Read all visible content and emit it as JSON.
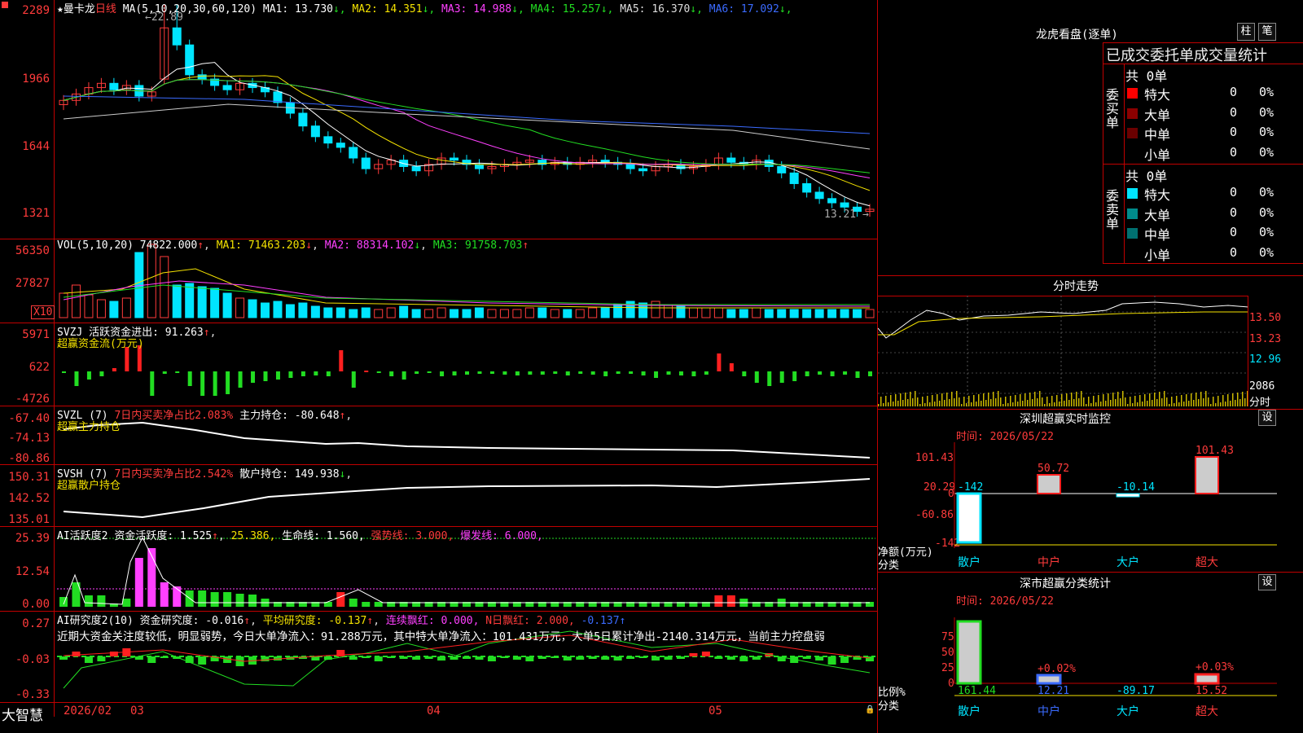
{
  "stock": {
    "star": "★",
    "name": "曼卡龙",
    "period": "日线"
  },
  "main": {
    "ma_title": "MA(5,10,20,30,60,120)",
    "ma": [
      {
        "label": "MA1: 13.730",
        "arrow": "↓",
        "color": "#ffffff"
      },
      {
        "label": "MA2: 14.351",
        "arrow": "↓",
        "color": "#f4e200"
      },
      {
        "label": "MA3: 14.988",
        "arrow": "↓",
        "color": "#ff40ff"
      },
      {
        "label": "MA4: 15.257",
        "arrow": "↓",
        "color": "#22dd22"
      },
      {
        "label": "MA5: 16.370",
        "arrow": "↓",
        "color": "#dddddd"
      },
      {
        "label": "MA6: 17.092",
        "arrow": "↓",
        "color": "#3b6bff"
      }
    ],
    "y_ticks": [
      "2289",
      "1966",
      "1644",
      "1321"
    ],
    "high_mark": "22.89",
    "low_mark": "13.21"
  },
  "vol": {
    "title": "VOL(5,10,20)",
    "v": "74822.000",
    "ma1": "MA1: 71463.203",
    "ma2": "MA2: 88314.102",
    "ma3": "MA3: 91758.703",
    "y_ticks": [
      "56350",
      "27827"
    ],
    "unit": "X10"
  },
  "svzj": {
    "title": "SVZJ",
    "t1": "活跃资金进出: 91.263",
    "t2": "超赢资金流(万元)",
    "y_ticks": [
      "5971",
      "622",
      "-4726"
    ]
  },
  "svzl": {
    "title": "SVZL (7)",
    "t1": "7日内买卖净占比2.083%",
    "t2": "主力持仓: -80.648",
    "t3": "超赢主力持仓",
    "y_ticks": [
      "-67.40",
      "-74.13",
      "-80.86"
    ]
  },
  "svsh": {
    "title": "SVSH (7)",
    "t1": "7日内买卖净占比2.542%",
    "t2": "散户持仓: 149.938",
    "t3": "超赢散户持仓",
    "y_ticks": [
      "150.31",
      "142.52",
      "135.01"
    ]
  },
  "ai1": {
    "title": "AI活跃度2",
    "t1": "资金活跃度: 1.525",
    "t2": "25.386,",
    "t3": "生命线: 1.560,",
    "t4": "强势线: 3.000,",
    "t5": "爆发线: 6.000,",
    "y_ticks": [
      "25.39",
      "12.54",
      "0.00"
    ]
  },
  "ai2": {
    "title": "AI研究度2(10)",
    "t1": "资金研究度: -0.016",
    "t2": "平均研究度: -0.137",
    "t3": "连续飘红: 0.000,",
    "t4": "N日飘红: 2.000,",
    "t5": "-0.137",
    "desc": "近期大资金关注度较低，明显弱势，今日大单净流入：91.288万元，其中特大单净流入：101.431万元，大单5日累计净出-2140.314万元，当前主力控盘弱",
    "y_ticks": [
      "0.27",
      "-0.03",
      "-0.33"
    ]
  },
  "xaxis": {
    "brand": "大智慧",
    "labels": [
      "2026/02",
      "03",
      "04",
      "05"
    ]
  },
  "lhb": {
    "title": "龙虎看盘(逐单)",
    "btn1": "柱",
    "btn2": "笔",
    "header": "已成交委托单成交量统计",
    "buy": {
      "side": "委买单",
      "count": "共 0单",
      "rows": [
        {
          "label": "特大",
          "v": "0",
          "p": "0%",
          "c": "#ff0000"
        },
        {
          "label": "大单",
          "v": "0",
          "p": "0%",
          "c": "#8b0000"
        },
        {
          "label": "中单",
          "v": "0",
          "p": "0%",
          "c": "#6b0000"
        },
        {
          "label": "小单",
          "v": "0",
          "p": "0%",
          "c": "#000"
        }
      ]
    },
    "sell": {
      "side": "委卖单",
      "count": "共 0单",
      "rows": [
        {
          "label": "特大",
          "v": "0",
          "p": "0%",
          "c": "#00e5ff"
        },
        {
          "label": "大单",
          "v": "0",
          "p": "0%",
          "c": "#008b8b"
        },
        {
          "label": "中单",
          "v": "0",
          "p": "0%",
          "c": "#007070"
        },
        {
          "label": "小单",
          "v": "0",
          "p": "0%",
          "c": "#000"
        }
      ]
    }
  },
  "fenshi": {
    "title": "分时走势",
    "y": [
      "13.50",
      "13.23",
      "12.96"
    ],
    "vol": "2086",
    "unit": "分时"
  },
  "monitor": {
    "title": "深圳超赢实时监控",
    "btn": "设",
    "time": "时间: 2026/05/22",
    "y": [
      "101.43",
      "20.29",
      "0",
      "-60.86",
      "-142"
    ],
    "ylabel": "净额(万元)",
    "xlabel": "分类",
    "cats": [
      "散户",
      "中户",
      "大户",
      "超大"
    ],
    "vals": [
      "-142",
      "50.72",
      "-10.14",
      "101.43"
    ]
  },
  "classify": {
    "title": "深市超赢分类统计",
    "btn": "设",
    "time": "时间: 2026/05/22",
    "y": [
      "75",
      "50",
      "25",
      "0"
    ],
    "ylabel": "比例%",
    "xlabel": "分类",
    "cats": [
      "散户",
      "中户",
      "大户",
      "超大"
    ],
    "vals": [
      "161.44",
      "12.21",
      "-89.17",
      "15.52"
    ],
    "pcts": [
      "+0.02%",
      "+0.03%"
    ]
  }
}
